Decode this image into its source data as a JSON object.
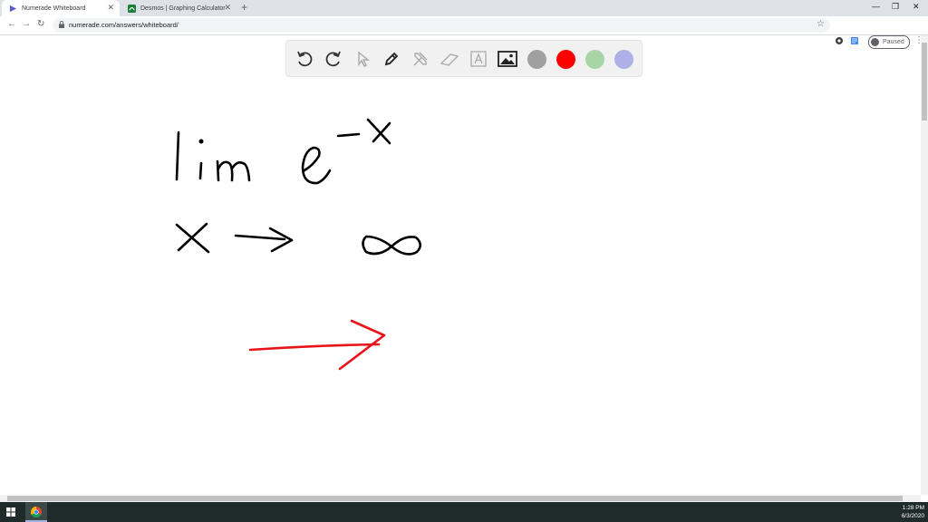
{
  "browser": {
    "tabs": [
      {
        "title": "Numerade Whiteboard",
        "active": true
      },
      {
        "title": "Desmos | Graphing Calculator",
        "active": false
      }
    ],
    "url": "numerade.com/answers/whiteboard/",
    "profile_label": "Paused"
  },
  "toolbar": {
    "tools": [
      "undo-icon",
      "redo-icon",
      "pointer-icon",
      "pen-icon",
      "tools-icon",
      "eraser-icon",
      "text-icon",
      "image-icon"
    ],
    "colors": [
      "#a0a0a0",
      "#ff0000",
      "#a8d5a8",
      "#b0b0e8"
    ]
  },
  "whiteboard": {
    "ink_colors": {
      "black": "#000000",
      "red": "#e8141a"
    },
    "content": "lim e^(-x), x → ∞, red arrow"
  },
  "taskbar": {
    "time": "1:28 PM",
    "date": "6/3/2020"
  }
}
